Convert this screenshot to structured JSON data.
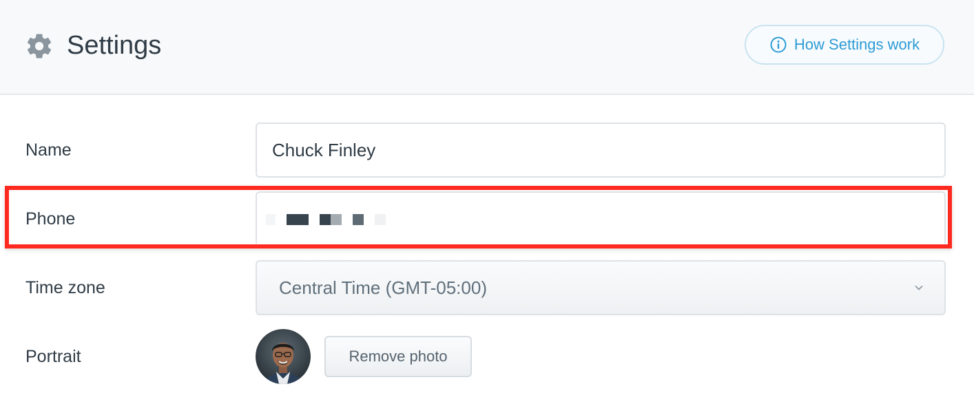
{
  "header": {
    "title": "Settings",
    "help_button_label": "How Settings work",
    "icon": "gear-icon"
  },
  "form": {
    "name": {
      "label": "Name",
      "value": "Chuck Finley"
    },
    "phone": {
      "label": "Phone",
      "value_redacted": true
    },
    "timezone": {
      "label": "Time zone",
      "selected": "Central Time (GMT-05:00)"
    },
    "portrait": {
      "label": "Portrait",
      "remove_label": "Remove photo"
    }
  },
  "colors": {
    "accent": "#2e9bd6",
    "highlight": "#ff2a1f",
    "text": "#2f3b45"
  }
}
